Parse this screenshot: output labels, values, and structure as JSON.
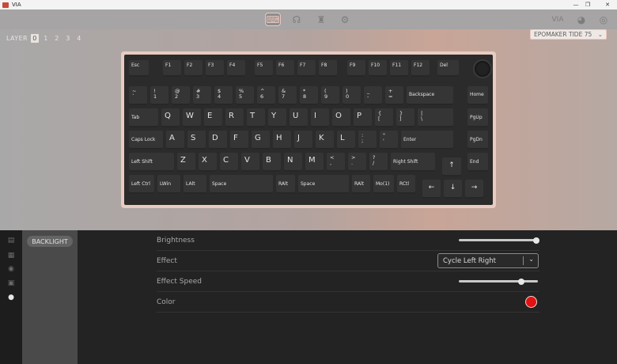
{
  "window": {
    "title": "VIA",
    "minimize": "—",
    "maximize": "❐",
    "close": "✕"
  },
  "toolbar": {
    "icons": [
      "keyboard-icon",
      "key-test-icon",
      "design-icon",
      "settings-icon"
    ],
    "right": {
      "via": "VIA",
      "discord": "◕",
      "github": "◎"
    }
  },
  "layers": {
    "label": "LAYER",
    "items": [
      "0",
      "1",
      "2",
      "3",
      "4"
    ],
    "selected": "0"
  },
  "device": {
    "name": "EPOMAKER TIDE 75",
    "chevron": "⌄"
  },
  "keys": {
    "esc": "Esc",
    "f1": "F1",
    "f2": "F2",
    "f3": "F3",
    "f4": "F4",
    "f5": "F5",
    "f6": "F6",
    "f7": "F7",
    "f8": "F8",
    "f9": "F9",
    "f10": "F10",
    "f11": "F11",
    "f12": "F12",
    "del": "Del",
    "grave_top": "~",
    "grave_bot": "`",
    "n1_top": "!",
    "n1_bot": "1",
    "n2_top": "@",
    "n2_bot": "2",
    "n3_top": "#",
    "n3_bot": "3",
    "n4_top": "$",
    "n4_bot": "4",
    "n5_top": "%",
    "n5_bot": "5",
    "n6_top": "^",
    "n6_bot": "6",
    "n7_top": "&",
    "n7_bot": "7",
    "n8_top": "*",
    "n8_bot": "8",
    "n9_top": "(",
    "n9_bot": "9",
    "n0_top": ")",
    "n0_bot": "0",
    "minus_top": "_",
    "minus_bot": "-",
    "equal_top": "+",
    "equal_bot": "=",
    "backspace": "Backspace",
    "home": "Home",
    "tab": "Tab",
    "q": "Q",
    "w": "W",
    "e": "E",
    "r": "R",
    "t": "T",
    "y": "Y",
    "u": "U",
    "i": "I",
    "o": "O",
    "p": "P",
    "lbr_top": "{",
    "lbr_bot": "[",
    "rbr_top": "}",
    "rbr_bot": "]",
    "bsl_top": "|",
    "bsl_bot": "\\",
    "pgup": "PgUp",
    "caps": "Caps Lock",
    "a": "A",
    "s": "S",
    "d": "D",
    "f": "F",
    "g": "G",
    "h": "H",
    "j": "J",
    "k": "K",
    "l": "L",
    "semi_top": ":",
    "semi_bot": ";",
    "quote_top": "\"",
    "quote_bot": "'",
    "enter": "Enter",
    "pgdn": "PgDn",
    "lshift": "Left Shift",
    "z": "Z",
    "x": "X",
    "c": "C",
    "v": "V",
    "b": "B",
    "n": "N",
    "m": "M",
    "comma_top": "<",
    "comma_bot": ",",
    "dot_top": ">",
    "dot_bot": ".",
    "slash_top": "?",
    "slash_bot": "/",
    "rshift": "Right Shift",
    "up": "↑",
    "end": "End",
    "lctrl": "Left Ctrl",
    "lwin": "LWin",
    "lalt": "LAlt",
    "space1": "Space",
    "ralt": "RAlt",
    "space2": "Space",
    "rctl_a": "RAlt",
    "rctl_b": "Mo(1)",
    "rctl_c": "RCtl",
    "left": "←",
    "down": "↓",
    "right": "→"
  },
  "panel": {
    "sidebar_icons": [
      "keymap-icon",
      "macros-icon",
      "lighting-dot-icon",
      "save-icon",
      "bulb-icon"
    ],
    "menu": {
      "backlight": "BACKLIGHT"
    },
    "settings": {
      "brightness": {
        "label": "Brightness",
        "value": 0.98
      },
      "effect": {
        "label": "Effect",
        "value": "Cycle Left Right",
        "chevron": "⌄"
      },
      "speed": {
        "label": "Effect Speed",
        "value": 0.79
      },
      "color": {
        "label": "Color",
        "hex": "#e21212"
      }
    }
  }
}
